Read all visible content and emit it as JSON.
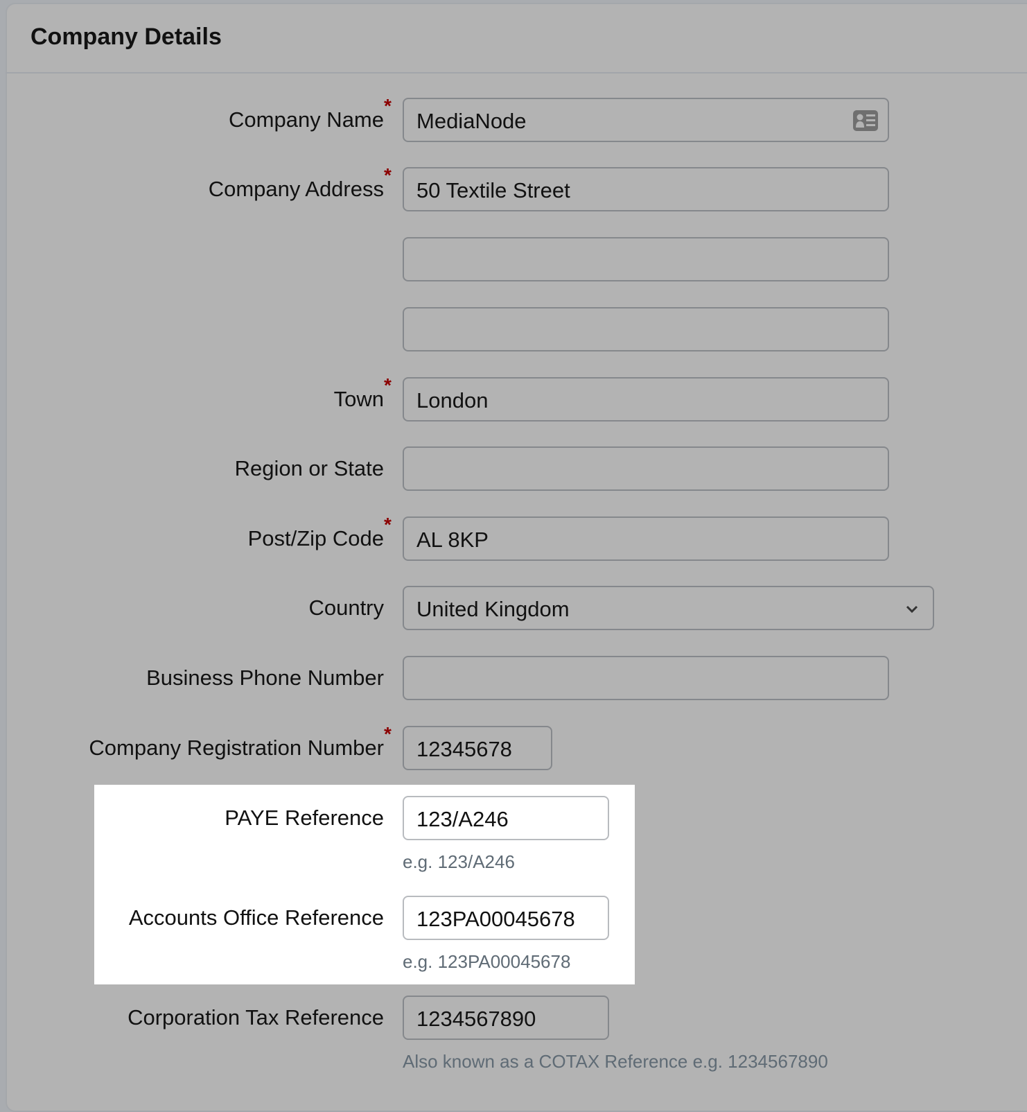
{
  "title": "Company Details",
  "fields": [
    {
      "label": "Company Name",
      "required": true,
      "value": "MediaNode",
      "icon": "contact-card-icon"
    },
    {
      "label": "Company Address",
      "required": true,
      "value": "50 Textile Street"
    },
    {
      "label": "",
      "required": false,
      "value": ""
    },
    {
      "label": "",
      "required": false,
      "value": ""
    },
    {
      "label": "Town",
      "required": true,
      "value": "London"
    },
    {
      "label": "Region or State",
      "required": false,
      "value": ""
    },
    {
      "label": "Post/Zip Code",
      "required": true,
      "value": "AL 8KP"
    },
    {
      "label": "Country",
      "required": false,
      "value": "United Kingdom",
      "icon": "chevron-down-icon"
    },
    {
      "label": "Business Phone Number",
      "required": false,
      "value": ""
    },
    {
      "label": "Company Registration Number",
      "required": true,
      "value": "12345678"
    },
    {
      "label": "PAYE Reference",
      "required": false,
      "value": "123/A246",
      "hint": "e.g. 123/A246"
    },
    {
      "label": "Accounts Office Reference",
      "required": false,
      "value": "123PA00045678",
      "hint": "e.g. 123PA00045678"
    },
    {
      "label": "Corporation Tax Reference",
      "required": false,
      "value": "1234567890",
      "hint": "Also known as a COTAX Reference e.g. 1234567890"
    }
  ],
  "required_marker": "*",
  "colors": {
    "required": "#8b0000",
    "highlight": "#ffffff",
    "background": "#b3b3b3"
  }
}
